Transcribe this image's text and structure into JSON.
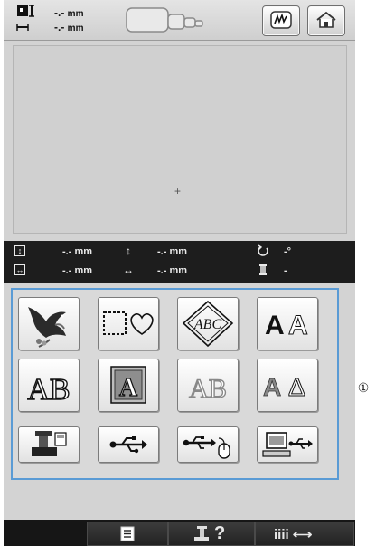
{
  "topbar": {
    "width_value": "-.-",
    "height_value": "-.-",
    "unit": "mm",
    "icons": [
      "size-icon",
      "hoop-icon",
      "embroidery-edit-icon",
      "home-icon"
    ]
  },
  "preview": {
    "center_mark": "+"
  },
  "infobar": {
    "height_value": "-.-",
    "height_unit": "mm",
    "width_value": "-.-",
    "width_unit": "mm",
    "vpos_value": "-.-",
    "vpos_unit": "mm",
    "hpos_value": "-.-",
    "hpos_unit": "mm",
    "angle_value": "-",
    "angle_unit": "°",
    "thread_value": "-"
  },
  "categories": {
    "items": [
      "embroidery-patterns",
      "frame-patterns",
      "monogram",
      "alphabet-fonts",
      "floral-alphabet",
      "cross-stitch-alphabet",
      "outline-alphabet",
      "greek-alphabet",
      "machine-memory",
      "usb-media",
      "usb-mouse-media",
      "computer-link"
    ],
    "abc_monogram": "ABC",
    "alpha_a1": "A",
    "alpha_a2": "A",
    "floral_ab": "AB",
    "cross_a": "A",
    "outline_ab": "AB",
    "greek_a": "A",
    "greek_delta": "Δ"
  },
  "callout": {
    "label": "①"
  },
  "bottombar": {
    "help_label": "?",
    "spacing_label": "iiii ⟷"
  },
  "colors": {
    "frame_blue": "#5a9bd5",
    "screen_gray": "#d3d3d3",
    "dark_bar": "#1d1d1d"
  }
}
